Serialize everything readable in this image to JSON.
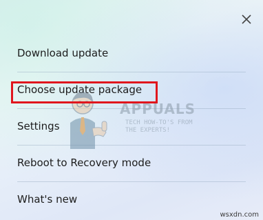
{
  "menu": {
    "items": [
      {
        "label": "Download update"
      },
      {
        "label": "Choose update package"
      },
      {
        "label": "Settings"
      },
      {
        "label": "Reboot to Recovery mode"
      },
      {
        "label": "What's new"
      }
    ]
  },
  "close": {
    "icon": "close-icon"
  },
  "highlight": {
    "color": "#e0161d",
    "target": "Choose update package"
  },
  "watermark": {
    "title": "APPUALS",
    "tagline_1": "TECH HOW-TO'S FROM",
    "tagline_2": "THE EXPERTS!"
  },
  "credit": "wsxdn.com"
}
